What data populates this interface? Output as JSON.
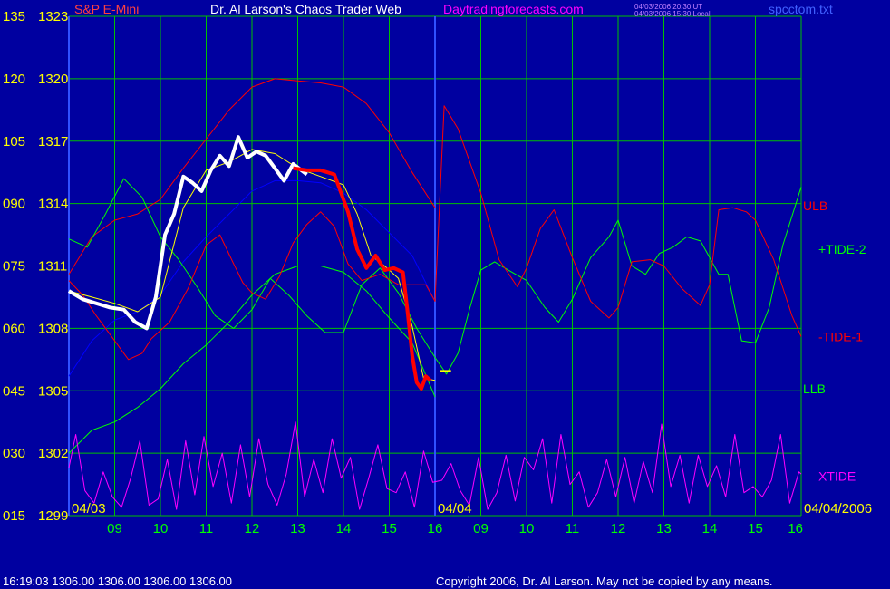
{
  "header": {
    "instrument": "S&P E-Mini",
    "title": "Dr. Al Larson's Chaos Trader Web",
    "site": "Daytradingforecasts.com",
    "stamp_utc": "04/03/2006 20:30 UT",
    "stamp_local": "04/03/2006 15:30 Local",
    "filename": "spcctom.txt"
  },
  "footer": {
    "quote": "16:19:03   1306.00  1306.00  1306.00  1306.00",
    "copyright": "Copyright 2006, Dr. Al Larson. May not be copied by any means."
  },
  "colors": {
    "background": "#0000a0",
    "grid": "#00c000",
    "price_up": "#ffffff",
    "price_down": "#ff0000",
    "moving_avg": "#ffff00",
    "ulb": "#ff0000",
    "llb": "#00ff00",
    "tide_plus": "#00ff00",
    "tide_minus": "#ff0000",
    "xtide": "#ff00ff",
    "mid_band": "#0000ff",
    "date_label": "#ffff00",
    "hour_label": "#00ff00",
    "left_axis_text": "#ffff00"
  },
  "chart_data": {
    "type": "line",
    "title": "Dr. Al Larson's Chaos Trader Web",
    "xlabel": "",
    "ylabel": "",
    "ylim": [
      1299,
      1323
    ],
    "grid": true,
    "price_ticks": [
      "1323",
      "1320",
      "1317",
      "1314",
      "1311",
      "1308",
      "1305",
      "1302",
      "1299"
    ],
    "osc_ticks": [
      "135",
      "120",
      "105",
      "090",
      "075",
      "060",
      "045",
      "030",
      "015"
    ],
    "date_labels": [
      {
        "text": "04/03",
        "x": 0
      },
      {
        "text": "04/04",
        "x": 8
      },
      {
        "text": "04/04/2006",
        "x": 16
      }
    ],
    "hour_labels": [
      {
        "text": "09",
        "x": 1
      },
      {
        "text": "10",
        "x": 2
      },
      {
        "text": "11",
        "x": 3
      },
      {
        "text": "12",
        "x": 4
      },
      {
        "text": "13",
        "x": 5
      },
      {
        "text": "14",
        "x": 6
      },
      {
        "text": "15",
        "x": 7
      },
      {
        "text": "16",
        "x": 8
      },
      {
        "text": "09",
        "x": 9
      },
      {
        "text": "10",
        "x": 10
      },
      {
        "text": "11",
        "x": 11
      },
      {
        "text": "12",
        "x": 12
      },
      {
        "text": "13",
        "x": 13
      },
      {
        "text": "14",
        "x": 14
      },
      {
        "text": "15",
        "x": 15
      },
      {
        "text": "16",
        "x": 16
      }
    ],
    "series_labels": [
      {
        "text": "ULB",
        "color": "#ff0000",
        "value": 1313.9
      },
      {
        "text": "+TIDE-2",
        "color": "#00ff00",
        "value": 1311.8
      },
      {
        "text": "-TIDE-1",
        "color": "#ff0000",
        "value": 1307.6
      },
      {
        "text": "LLB",
        "color": "#00ff00",
        "value": 1305.1
      },
      {
        "text": "XTIDE",
        "color": "#ff00ff",
        "value": 1300.9
      }
    ],
    "series": [
      {
        "name": "ULB",
        "color": "#ff0000",
        "x": [
          0,
          0.5,
          1,
          1.5,
          2,
          2.5,
          3,
          3.5,
          4,
          4.5,
          5,
          5.5,
          6,
          6.5,
          7,
          7.5,
          8
        ],
        "values": [
          1310.6,
          1312.4,
          1313.2,
          1313.5,
          1314.2,
          1315.7,
          1317.1,
          1318.5,
          1319.6,
          1320.0,
          1319.9,
          1319.8,
          1319.6,
          1318.8,
          1317.4,
          1315.5,
          1313.8
        ]
      },
      {
        "name": "LLB",
        "color": "#00ff00",
        "x": [
          0,
          0.5,
          1,
          1.5,
          2,
          2.5,
          3,
          3.5,
          4,
          4.5,
          5,
          5.5,
          6,
          6.5,
          7,
          7.5,
          8
        ],
        "values": [
          1302.0,
          1303.1,
          1303.5,
          1304.2,
          1305.1,
          1306.3,
          1307.2,
          1308.3,
          1309.6,
          1310.6,
          1311.0,
          1311.0,
          1310.7,
          1309.8,
          1308.5,
          1307.3,
          1304.7
        ]
      },
      {
        "name": "Mid band",
        "color": "#0000ff",
        "x": [
          0,
          0.5,
          1,
          1.5,
          2,
          2.5,
          3,
          3.5,
          4,
          4.5,
          5,
          5.5,
          6,
          6.5,
          7,
          7.5,
          8
        ],
        "values": [
          1305.7,
          1307.4,
          1308.4,
          1308.8,
          1309.6,
          1311.2,
          1312.4,
          1313.5,
          1314.6,
          1315.1,
          1315.1,
          1315.0,
          1314.5,
          1313.7,
          1312.6,
          1311.5,
          1309.3
        ]
      },
      {
        "name": "+TIDE-2",
        "color": "#00ff00",
        "x": [
          0,
          0.4,
          0.8,
          1.2,
          1.6,
          2,
          2.4,
          2.8,
          3.2,
          3.6,
          4,
          4.4,
          4.8,
          5.2,
          5.6,
          6,
          6.4,
          6.8,
          7.2,
          7.6,
          8,
          8.25,
          8.5,
          8.75,
          9,
          9.3,
          9.6,
          10,
          10.4,
          10.7,
          11,
          11.4,
          11.8,
          12,
          12.3,
          12.6,
          12.9,
          13.2,
          13.5,
          13.8,
          14,
          14.2,
          14.4,
          14.7,
          15,
          15.3,
          15.6,
          16
        ],
        "values": [
          1312.3,
          1311.9,
          1313.5,
          1315.2,
          1314.3,
          1312.4,
          1311.3,
          1310.0,
          1308.6,
          1308.0,
          1308.9,
          1310.4,
          1309.6,
          1308.6,
          1307.8,
          1307.8,
          1310.1,
          1310.9,
          1309.7,
          1308.0,
          1306.6,
          1305.8,
          1306.8,
          1308.9,
          1310.8,
          1311.2,
          1310.8,
          1310.3,
          1309.0,
          1308.3,
          1309.4,
          1311.4,
          1312.4,
          1313.2,
          1311.0,
          1310.6,
          1311.6,
          1311.9,
          1312.4,
          1312.2,
          1311.4,
          1310.6,
          1310.6,
          1307.4,
          1307.3,
          1309.0,
          1312.0,
          1314.8
        ]
      },
      {
        "name": "-TIDE-1",
        "color": "#ff0000",
        "x": [
          0,
          0.3,
          0.6,
          1,
          1.3,
          1.6,
          1.8,
          2.2,
          2.6,
          3,
          3.3,
          3.6,
          3.8,
          4,
          4.3,
          4.6,
          4.9,
          5.2,
          5.5,
          5.8,
          6.1,
          6.4,
          6.8,
          7.2,
          7.5,
          7.8,
          8,
          8.2,
          8.5,
          9,
          9.4,
          9.8,
          10,
          10.3,
          10.6,
          11,
          11.4,
          11.8,
          12,
          12.3,
          12.7,
          13,
          13.4,
          13.8,
          14,
          14.2,
          14.5,
          14.8,
          15,
          15.4,
          15.8,
          16
        ],
        "values": [
          1310.3,
          1309.6,
          1308.6,
          1307.4,
          1306.5,
          1306.8,
          1307.5,
          1308.3,
          1309.9,
          1312.0,
          1312.5,
          1311.1,
          1310.2,
          1309.7,
          1309.4,
          1310.5,
          1312.1,
          1313.0,
          1313.6,
          1312.9,
          1311.1,
          1310.3,
          1310.6,
          1310.1,
          1310.1,
          1310.1,
          1309.3,
          1318.7,
          1317.6,
          1314.5,
          1311.3,
          1310.0,
          1310.9,
          1312.8,
          1313.7,
          1311.4,
          1309.3,
          1308.5,
          1309.0,
          1311.2,
          1311.3,
          1311.0,
          1309.9,
          1309.1,
          1310.1,
          1313.7,
          1313.8,
          1313.6,
          1313.2,
          1311.3,
          1308.6,
          1307.6
        ]
      },
      {
        "name": "Moving average",
        "color": "#ffff00",
        "x": [
          0,
          0.5,
          1,
          1.5,
          2,
          2.5,
          3,
          3.5,
          4,
          4.5,
          5,
          5.5,
          6,
          6.3,
          6.6,
          6.9,
          7.2,
          7.5,
          7.75,
          8
        ],
        "values": [
          1309.8,
          1309.5,
          1309.2,
          1308.8,
          1309.5,
          1313.8,
          1315.6,
          1316.0,
          1316.6,
          1316.4,
          1315.7,
          1315.3,
          1314.9,
          1313.5,
          1311.5,
          1311.0,
          1310.4,
          1308.1,
          1305.6,
          1305.5
        ]
      },
      {
        "name": "XTIDE",
        "color": "#ff00ff",
        "x": [
          0,
          0.15,
          0.35,
          0.55,
          0.75,
          0.95,
          1.15,
          1.35,
          1.55,
          1.75,
          1.95,
          2.15,
          2.35,
          2.55,
          2.75,
          2.95,
          3.15,
          3.35,
          3.55,
          3.75,
          3.95,
          4.15,
          4.35,
          4.55,
          4.75,
          4.95,
          5.15,
          5.35,
          5.55,
          5.75,
          5.95,
          6.15,
          6.35,
          6.55,
          6.75,
          6.95,
          7.15,
          7.35,
          7.55,
          7.75,
          7.95,
          8.15,
          8.35,
          8.55,
          8.75,
          8.95,
          9.15,
          9.35,
          9.55,
          9.75,
          9.95,
          10.15,
          10.35,
          10.55,
          10.75,
          10.95,
          11.15,
          11.35,
          11.55,
          11.75,
          11.95,
          12.15,
          12.35,
          12.55,
          12.75,
          12.95,
          13.15,
          13.35,
          13.55,
          13.75,
          13.95,
          14.15,
          14.35,
          14.55,
          14.75,
          14.95,
          15.15,
          15.35,
          15.55,
          15.75,
          15.95,
          16
        ],
        "values": [
          1301.3,
          1302.9,
          1300.2,
          1299.6,
          1301.1,
          1299.9,
          1299.4,
          1300.8,
          1302.6,
          1299.5,
          1299.8,
          1301.7,
          1299.3,
          1302.6,
          1300.0,
          1302.8,
          1300.4,
          1302.0,
          1299.6,
          1302.4,
          1299.9,
          1302.7,
          1300.5,
          1299.5,
          1301.0,
          1303.5,
          1299.9,
          1301.7,
          1300.1,
          1302.7,
          1300.8,
          1301.8,
          1299.3,
          1300.8,
          1302.4,
          1300.3,
          1300.1,
          1301.1,
          1299.4,
          1302.1,
          1300.6,
          1300.7,
          1301.5,
          1300.2,
          1299.5,
          1301.8,
          1299.3,
          1300.1,
          1301.9,
          1299.7,
          1301.8,
          1301.2,
          1302.7,
          1299.6,
          1302.9,
          1300.5,
          1301.1,
          1299.4,
          1300.1,
          1301.7,
          1299.9,
          1301.8,
          1299.6,
          1301.6,
          1300.1,
          1303.4,
          1300.4,
          1301.9,
          1299.6,
          1301.9,
          1300.4,
          1301.4,
          1299.9,
          1302.9,
          1300.1,
          1300.4,
          1299.9,
          1300.7,
          1302.9,
          1299.6,
          1301.1,
          1301.0
        ]
      },
      {
        "name": "Price up",
        "color": "#ffffff",
        "x": [
          0,
          0.3,
          0.6,
          0.9,
          1.2,
          1.45,
          1.7,
          1.9,
          2.1,
          2.3,
          2.5,
          2.7,
          2.9,
          3.1,
          3.3,
          3.5,
          3.7,
          3.9,
          4.1,
          4.3,
          4.5,
          4.7,
          4.9,
          5.2
        ],
        "values": [
          1309.8,
          1309.4,
          1309.2,
          1309.0,
          1308.9,
          1308.3,
          1308.0,
          1309.5,
          1312.5,
          1313.5,
          1315.3,
          1315.0,
          1314.6,
          1315.6,
          1316.3,
          1315.8,
          1317.2,
          1316.2,
          1316.5,
          1316.3,
          1315.7,
          1315.1,
          1315.9,
          1315.4
        ]
      },
      {
        "name": "Price down",
        "color": "#ff0000",
        "x": [
          4.9,
          5.2,
          5.5,
          5.8,
          6.1,
          6.3,
          6.5,
          6.7,
          6.9,
          7.1,
          7.3,
          7.4,
          7.5,
          7.6,
          7.7,
          7.8,
          7.9
        ],
        "values": [
          1315.7,
          1315.6,
          1315.6,
          1315.4,
          1313.6,
          1311.8,
          1310.9,
          1311.5,
          1310.8,
          1310.9,
          1310.7,
          1308.8,
          1306.7,
          1305.4,
          1305.1,
          1305.7,
          1305.5
        ]
      },
      {
        "name": "Last price",
        "color": "#ffff00",
        "x": [
          8.1,
          8.35
        ],
        "values": [
          1305.95,
          1305.95
        ]
      }
    ]
  }
}
